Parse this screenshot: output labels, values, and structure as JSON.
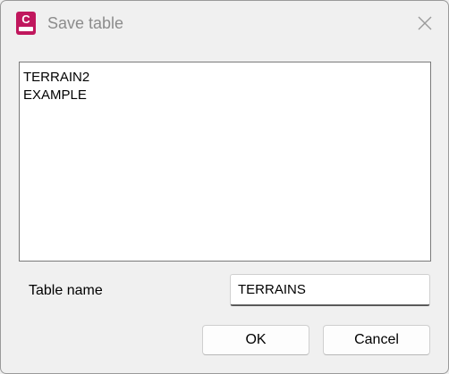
{
  "window": {
    "title": "Save table",
    "app_icon_letter": "C",
    "close_icon": "close-icon"
  },
  "list": {
    "items": [
      "TERRAIN2",
      "EXAMPLE"
    ]
  },
  "form": {
    "table_name_label": "Table name",
    "table_name_value": "TERRAINS"
  },
  "buttons": {
    "ok_label": "OK",
    "cancel_label": "Cancel"
  },
  "colors": {
    "app_icon": "#c0175d",
    "background": "#f0f0f0"
  }
}
